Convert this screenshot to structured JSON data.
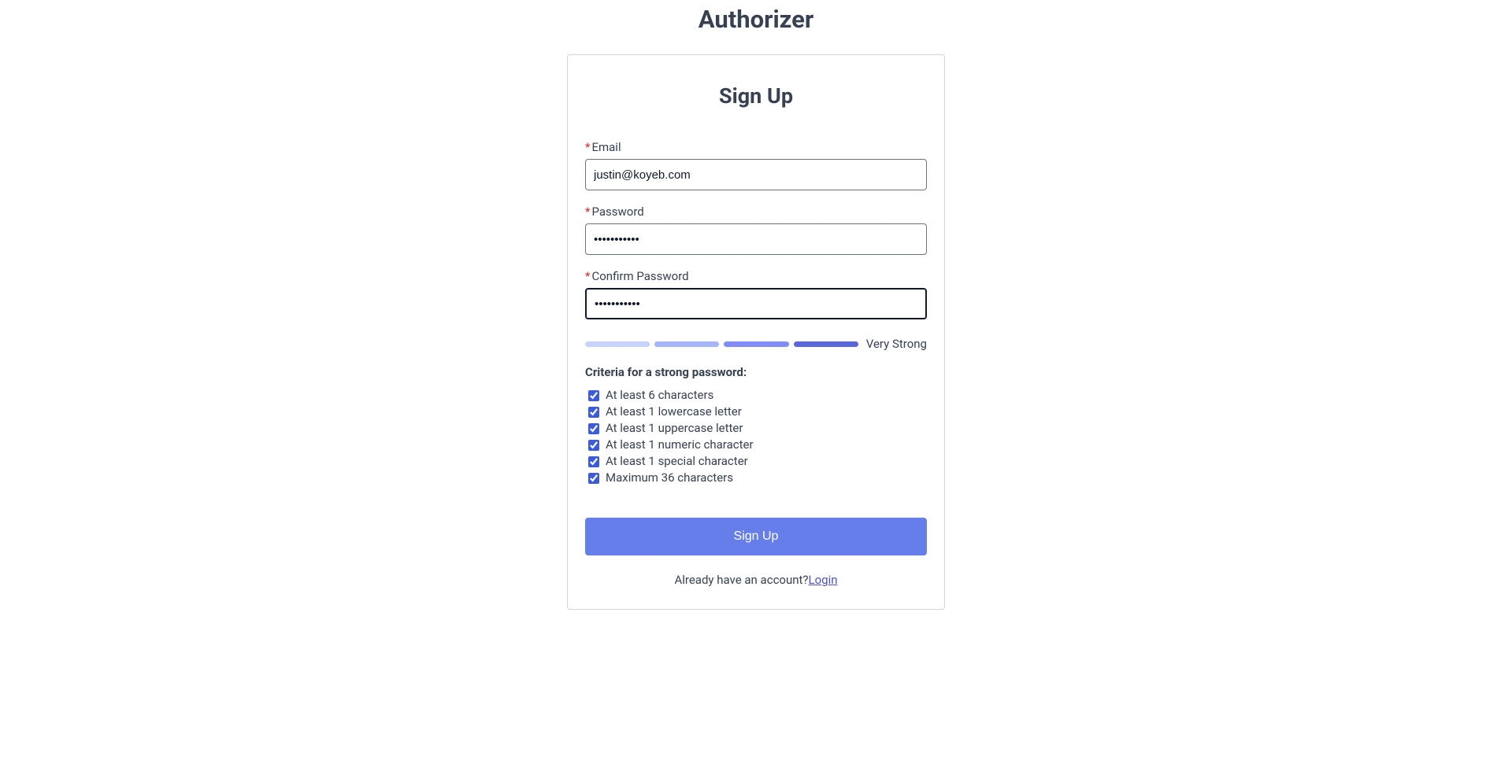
{
  "page_title": "Authorizer",
  "form": {
    "title": "Sign Up",
    "email": {
      "label": "Email",
      "value": "justin@koyeb.com"
    },
    "password": {
      "label": "Password",
      "value": "•••••••••••"
    },
    "confirm_password": {
      "label": "Confirm Password",
      "value": "•••••••••••"
    },
    "strength": {
      "label": "Very Strong",
      "bars": [
        {
          "color": "#c7d2fe"
        },
        {
          "color": "#a5b4fc"
        },
        {
          "color": "#818cf8"
        },
        {
          "color": "#5a67d8"
        }
      ]
    },
    "criteria_title": "Criteria for a strong password:",
    "criteria": [
      {
        "label": "At least 6 characters",
        "met": true
      },
      {
        "label": "At least 1 lowercase letter",
        "met": true
      },
      {
        "label": "At least 1 uppercase letter",
        "met": true
      },
      {
        "label": "At least 1 numeric character",
        "met": true
      },
      {
        "label": "At least 1 special character",
        "met": true
      },
      {
        "label": "Maximum 36 characters",
        "met": true
      }
    ],
    "submit_label": "Sign Up",
    "footer_prompt": "Already have an account?",
    "footer_link": "Login"
  }
}
